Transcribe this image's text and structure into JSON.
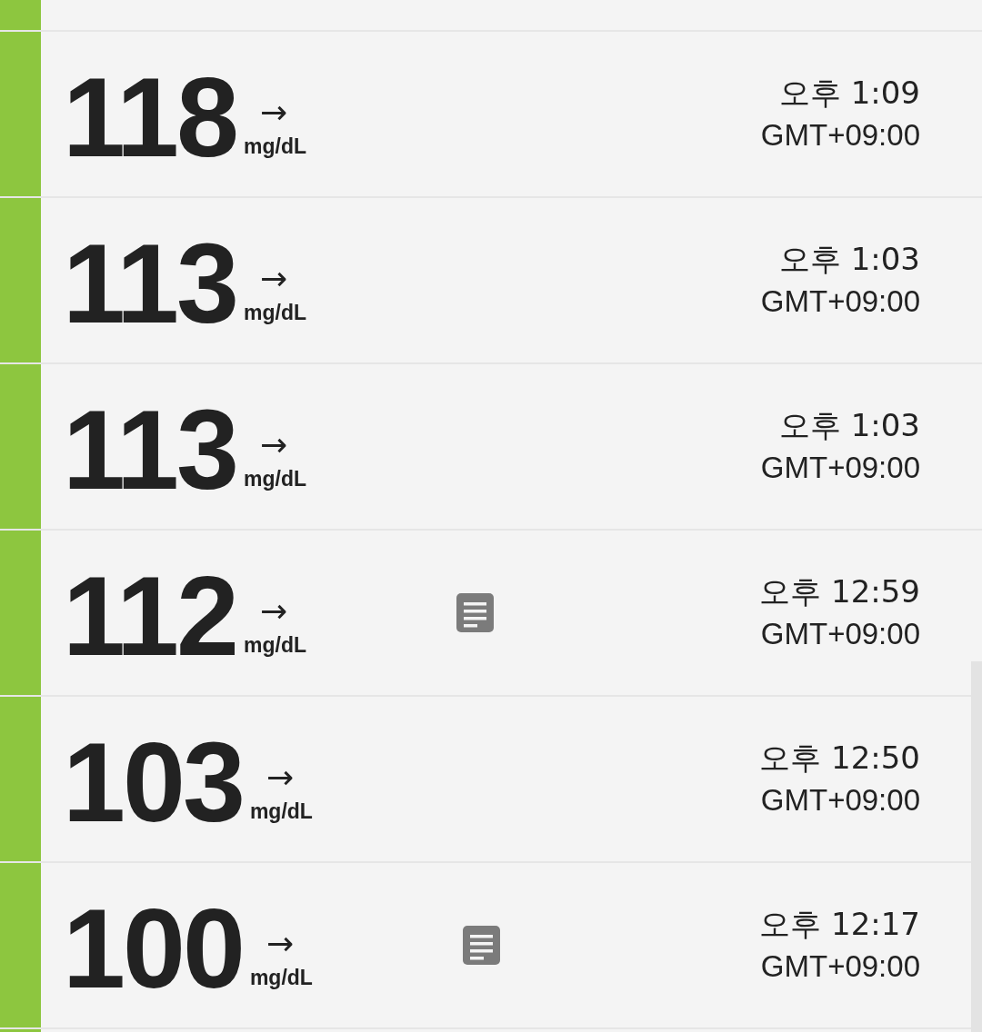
{
  "readings": [
    {
      "value": "118",
      "trend": "→",
      "unit": "mg/dL",
      "has_note": false,
      "time": "오후 1:09",
      "timezone": "GMT+09:00"
    },
    {
      "value": "113",
      "trend": "→",
      "unit": "mg/dL",
      "has_note": false,
      "time": "오후 1:03",
      "timezone": "GMT+09:00"
    },
    {
      "value": "113",
      "trend": "→",
      "unit": "mg/dL",
      "has_note": false,
      "time": "오후 1:03",
      "timezone": "GMT+09:00"
    },
    {
      "value": "112",
      "trend": "→",
      "unit": "mg/dL",
      "has_note": true,
      "time": "오후 12:59",
      "timezone": "GMT+09:00"
    },
    {
      "value": "103",
      "trend": "→",
      "unit": "mg/dL",
      "has_note": false,
      "time": "오후 12:50",
      "timezone": "GMT+09:00"
    },
    {
      "value": "100",
      "trend": "→",
      "unit": "mg/dL",
      "has_note": true,
      "time": "오후 12:17",
      "timezone": "GMT+09:00"
    }
  ]
}
